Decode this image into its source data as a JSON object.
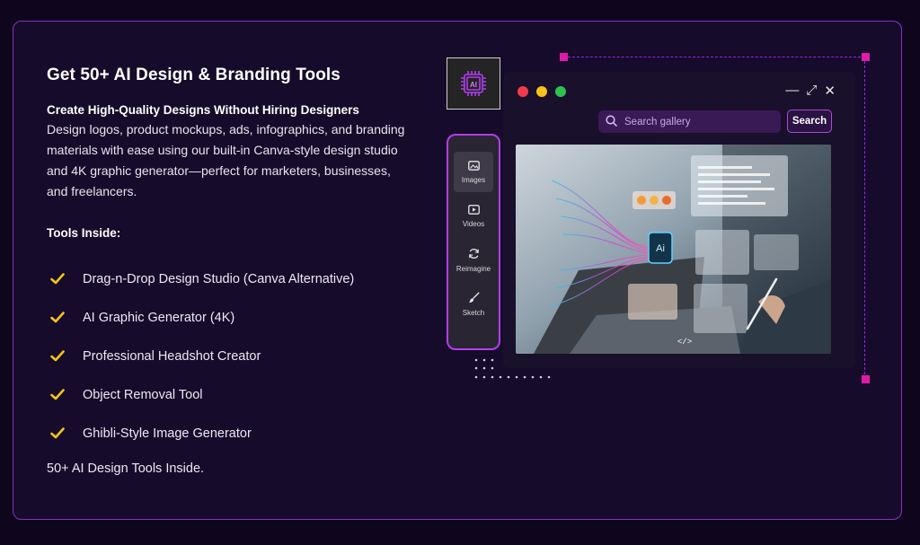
{
  "heading": {
    "title": "Get 50+ AI Design & Branding Tools",
    "subtitle": "Create High-Quality Designs Without Hiring Designers",
    "description": "Design logos, product mockups, ads, infographics, and branding materials with ease using our built-in Canva-style design studio and 4K graphic generator—perfect for marketers, businesses, and freelancers."
  },
  "tools": {
    "heading": "Tools Inside:",
    "items": [
      "Drag-n-Drop Design Studio (Canva Alternative)",
      "AI Graphic Generator (4K)",
      "Professional Headshot Creator",
      "Object Removal Tool",
      "Ghibli-Style Image Generator"
    ],
    "footer": "50+ AI Design Tools Inside."
  },
  "mockup": {
    "search_placeholder": "Search gallery",
    "search_button": "Search",
    "window_controls": {
      "minimize": "—",
      "maximize": "⤢",
      "close": "✕"
    },
    "sidebar": [
      {
        "label": "Images",
        "icon": "image-icon"
      },
      {
        "label": "Videos",
        "icon": "video-icon"
      },
      {
        "label": "Reimagine",
        "icon": "refresh-icon"
      },
      {
        "label": "Sketch",
        "icon": "brush-icon"
      }
    ],
    "chip_label": "AI",
    "photo_ai_label": "Ai",
    "photo_code_label": "</>"
  },
  "colors": {
    "accent": "#a020f0",
    "check": "#f5c518",
    "handle": "#e01aa8"
  }
}
